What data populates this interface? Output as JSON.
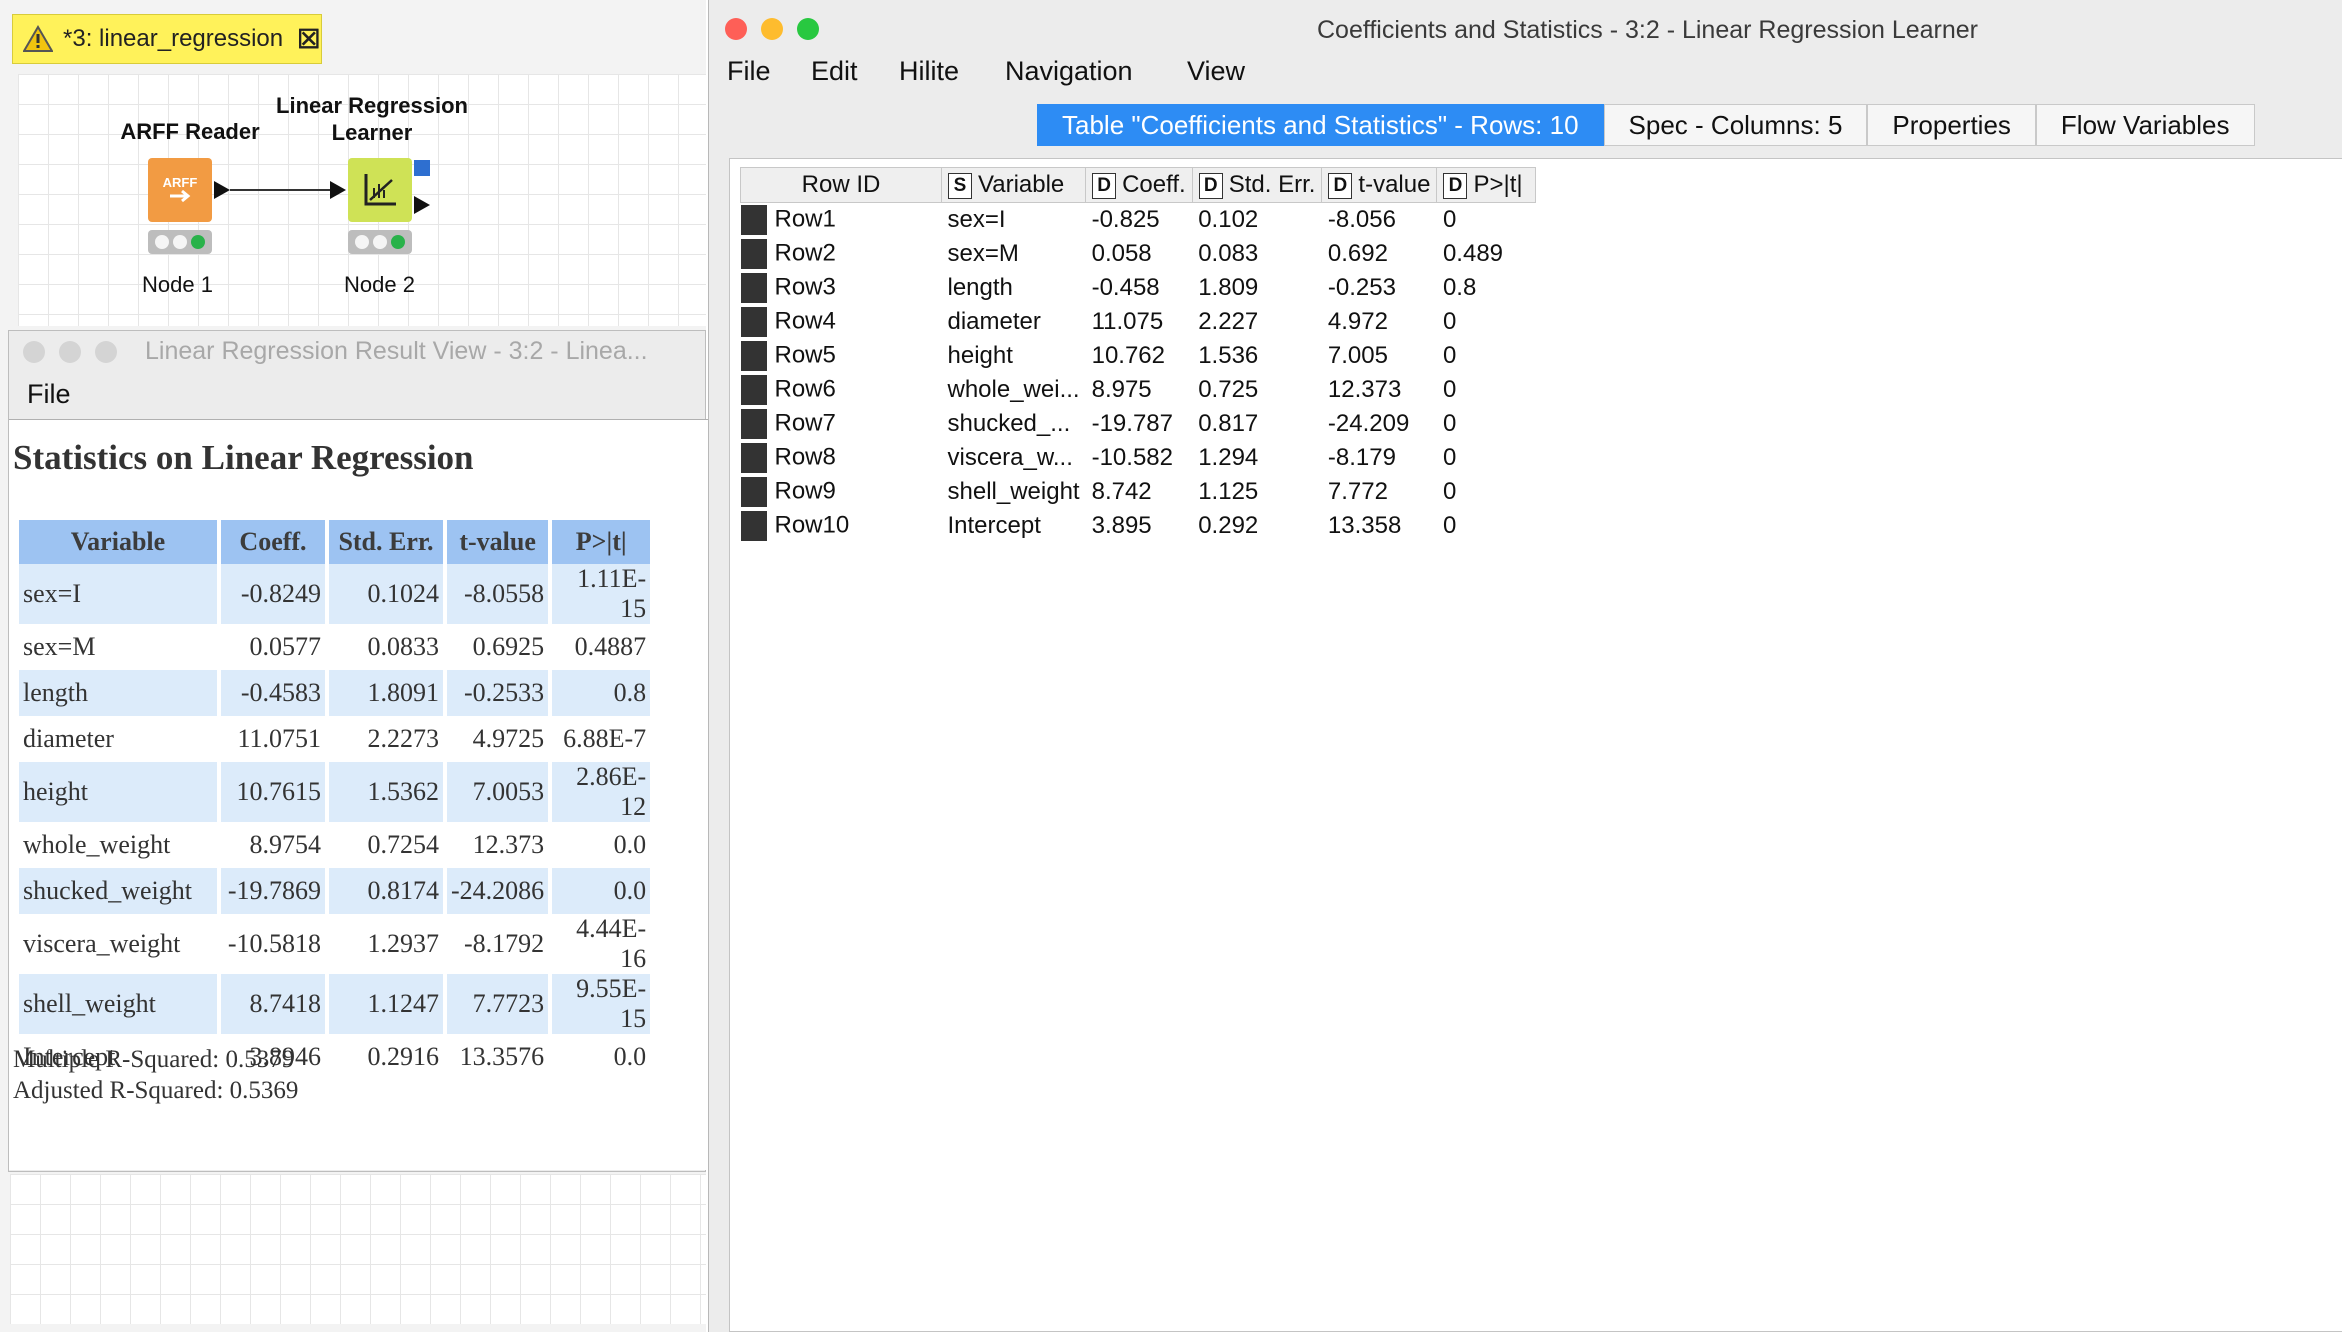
{
  "workflow": {
    "tab_title": "*3: linear_regression",
    "nodes": [
      {
        "title": "ARFF Reader",
        "label": "Node 1",
        "color": "#f29b43",
        "icon": "arff-icon"
      },
      {
        "title_line1": "Linear Regression",
        "title_line2": "Learner",
        "label": "Node 2",
        "color": "#cfe256",
        "icon": "regression-chart-icon"
      }
    ]
  },
  "result_view": {
    "title": "Linear Regression Result View - 3:2 - Linea...",
    "menu": [
      "File"
    ],
    "heading": "Statistics on Linear Regression",
    "columns": [
      "Variable",
      "Coeff.",
      "Std. Err.",
      "t-value",
      "P>|t|"
    ],
    "rows": [
      [
        "sex=I",
        "-0.8249",
        "0.1024",
        "-8.0558",
        "1.11E-15"
      ],
      [
        "sex=M",
        "0.0577",
        "0.0833",
        "0.6925",
        "0.4887"
      ],
      [
        "length",
        "-0.4583",
        "1.8091",
        "-0.2533",
        "0.8"
      ],
      [
        "diameter",
        "11.0751",
        "2.2273",
        "4.9725",
        "6.88E-7"
      ],
      [
        "height",
        "10.7615",
        "1.5362",
        "7.0053",
        "2.86E-12"
      ],
      [
        "whole_weight",
        "8.9754",
        "0.7254",
        "12.373",
        "0.0"
      ],
      [
        "shucked_weight",
        "-19.7869",
        "0.8174",
        "-24.2086",
        "0.0"
      ],
      [
        "viscera_weight",
        "-10.5818",
        "1.2937",
        "-8.1792",
        "4.44E-16"
      ],
      [
        "shell_weight",
        "8.7418",
        "1.1247",
        "7.7723",
        "9.55E-15"
      ],
      [
        "Intercept",
        "3.8946",
        "0.2916",
        "13.3576",
        "0.0"
      ]
    ],
    "multiple_r2": "Multiple R-Squared: 0.5379",
    "adjusted_r2": "Adjusted R-Squared: 0.5369"
  },
  "coef_window": {
    "title": "Coefficients and Statistics - 3:2 - Linear Regression Learner",
    "menu": [
      "File",
      "Edit",
      "Hilite",
      "Navigation",
      "View"
    ],
    "tabs": [
      "Table \"Coefficients and Statistics\" - Rows: 10",
      "Spec - Columns: 5",
      "Properties",
      "Flow Variables"
    ],
    "active_tab": 0,
    "header_rowid": "Row ID",
    "columns": [
      {
        "type": "S",
        "name": "Variable"
      },
      {
        "type": "D",
        "name": "Coeff."
      },
      {
        "type": "D",
        "name": "Std. Err."
      },
      {
        "type": "D",
        "name": "t-value"
      },
      {
        "type": "D",
        "name": "P>|t|"
      }
    ],
    "rows": [
      [
        "Row1",
        "sex=I",
        "-0.825",
        "0.102",
        "-8.056",
        "0"
      ],
      [
        "Row2",
        "sex=M",
        "0.058",
        "0.083",
        "0.692",
        "0.489"
      ],
      [
        "Row3",
        "length",
        "-0.458",
        "1.809",
        "-0.253",
        "0.8"
      ],
      [
        "Row4",
        "diameter",
        "11.075",
        "2.227",
        "4.972",
        "0"
      ],
      [
        "Row5",
        "height",
        "10.762",
        "1.536",
        "7.005",
        "0"
      ],
      [
        "Row6",
        "whole_wei...",
        "8.975",
        "0.725",
        "12.373",
        "0"
      ],
      [
        "Row7",
        "shucked_...",
        "-19.787",
        "0.817",
        "-24.209",
        "0"
      ],
      [
        "Row8",
        "viscera_w...",
        "-10.582",
        "1.294",
        "-8.179",
        "0"
      ],
      [
        "Row9",
        "shell_weight",
        "8.742",
        "1.125",
        "7.772",
        "0"
      ],
      [
        "Row10",
        "Intercept",
        "3.895",
        "0.292",
        "13.358",
        "0"
      ]
    ]
  },
  "colors": {
    "tab_active": "#2d8cf4",
    "stats_header": "#9dc3f2",
    "stats_alt_row": "#dcebfa",
    "close_button": "#fe5f57",
    "minimize_button": "#febc2e",
    "zoom_button": "#28c840"
  }
}
